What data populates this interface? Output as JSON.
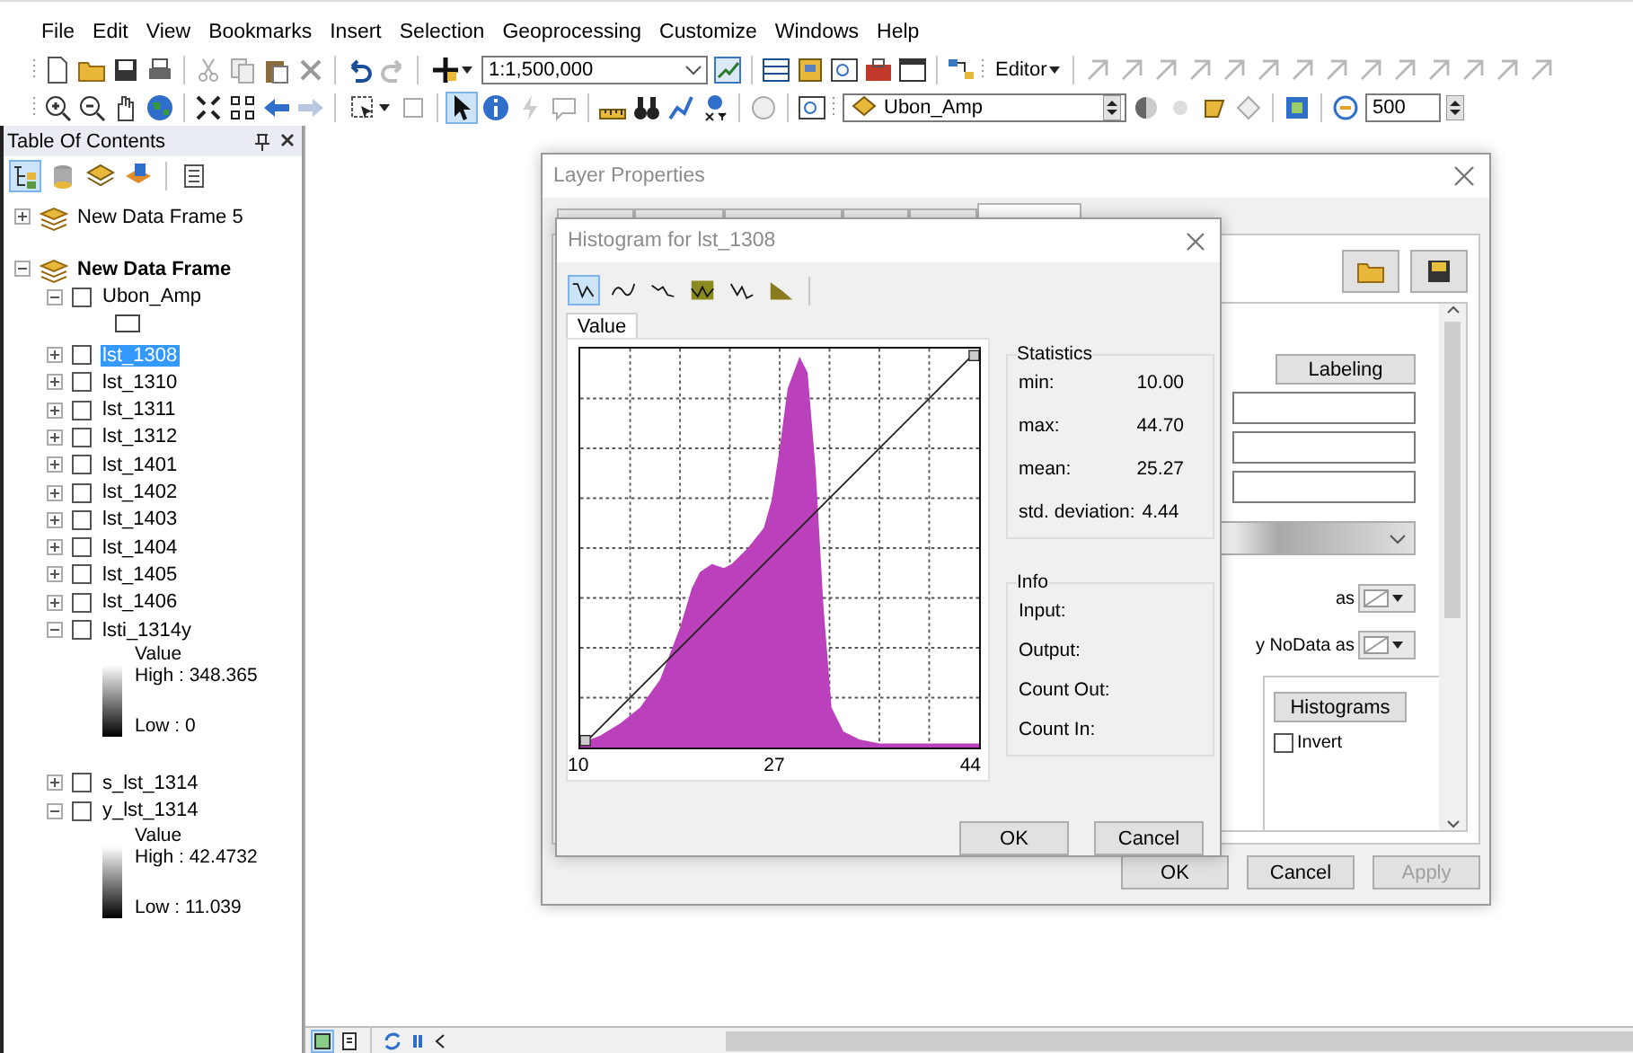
{
  "menu": [
    "File",
    "Edit",
    "View",
    "Bookmarks",
    "Insert",
    "Selection",
    "Geoprocessing",
    "Customize",
    "Windows",
    "Help"
  ],
  "toolbar": {
    "scale": "1:1,500,000",
    "editor": "Editor",
    "layer": "Ubon_Amp",
    "resolution": "500"
  },
  "toc": {
    "title": "Table Of Contents",
    "frames": [
      {
        "name": "New Data Frame 5",
        "expanded": false,
        "active": false
      },
      {
        "name": "New Data Frame",
        "expanded": true,
        "active": true,
        "layers": [
          {
            "name": "Ubon_Amp",
            "checked": false,
            "expanded": true,
            "selected": false,
            "legend": {
              "kind": "symbol"
            }
          },
          {
            "name": "lst_1308",
            "checked": false,
            "expanded": false,
            "selected": true
          },
          {
            "name": "lst_1310",
            "checked": false,
            "expanded": false,
            "selected": false
          },
          {
            "name": "lst_1311",
            "checked": false,
            "expanded": false,
            "selected": false
          },
          {
            "name": "lst_1312",
            "checked": false,
            "expanded": false,
            "selected": false
          },
          {
            "name": "lst_1401",
            "checked": false,
            "expanded": false,
            "selected": false
          },
          {
            "name": "lst_1402",
            "checked": false,
            "expanded": false,
            "selected": false
          },
          {
            "name": "lst_1403",
            "checked": false,
            "expanded": false,
            "selected": false
          },
          {
            "name": "lst_1404",
            "checked": false,
            "expanded": false,
            "selected": false
          },
          {
            "name": "lst_1405",
            "checked": false,
            "expanded": false,
            "selected": false
          },
          {
            "name": "lst_1406",
            "checked": false,
            "expanded": false,
            "selected": false
          },
          {
            "name": "lsti_1314y",
            "checked": false,
            "expanded": true,
            "selected": false,
            "legend": {
              "kind": "ramp",
              "heading": "Value",
              "high": "High : 348.365",
              "low": "Low : 0"
            }
          },
          {
            "name": "s_lst_1314",
            "checked": false,
            "expanded": false,
            "selected": false
          },
          {
            "name": "y_lst_1314",
            "checked": false,
            "expanded": true,
            "selected": false,
            "legend": {
              "kind": "ramp",
              "heading": "Value",
              "high": "High : 42.4732",
              "low": "Low : 11.039"
            }
          }
        ]
      }
    ]
  },
  "layer_properties": {
    "title": "Layer Properties",
    "tabs": [
      {
        "selected": false
      },
      {
        "selected": false
      },
      {
        "selected": false
      },
      {
        "selected": false
      },
      {
        "selected": false
      },
      {
        "selected": true
      }
    ],
    "labeling_button": "Labeling",
    "background_label": "as",
    "nodata_label": "y NoData as",
    "histograms_button": "Histograms",
    "invert": {
      "label": "Invert",
      "checked": false
    },
    "buttons": [
      {
        "label": "OK",
        "disabled": false
      },
      {
        "label": "Cancel",
        "disabled": false
      },
      {
        "label": "Apply",
        "disabled": true
      }
    ]
  },
  "histogram": {
    "title": "Histogram for lst_1308",
    "tools": [
      {
        "selected": true
      },
      {
        "selected": false
      },
      {
        "selected": false
      },
      {
        "selected": false
      },
      {
        "selected": false
      },
      {
        "selected": false
      }
    ],
    "tab": "Value",
    "x_labels": [
      "10",
      "27",
      "44"
    ],
    "statistics": {
      "title": "Statistics",
      "rows": [
        {
          "label": "min:",
          "value": "10.00"
        },
        {
          "label": "max:",
          "value": "44.70"
        },
        {
          "label": "mean:",
          "value": "25.27"
        },
        {
          "label": "std. deviation:",
          "value": "4.44"
        }
      ]
    },
    "info": {
      "title": "Info",
      "rows": [
        "Input:",
        "Output:",
        "Count Out:",
        "Count In:"
      ]
    },
    "buttons": [
      "OK",
      "Cancel"
    ]
  },
  "map": {
    "view_buttons": [
      {
        "selected": true
      },
      {
        "selected": false
      }
    ]
  }
}
